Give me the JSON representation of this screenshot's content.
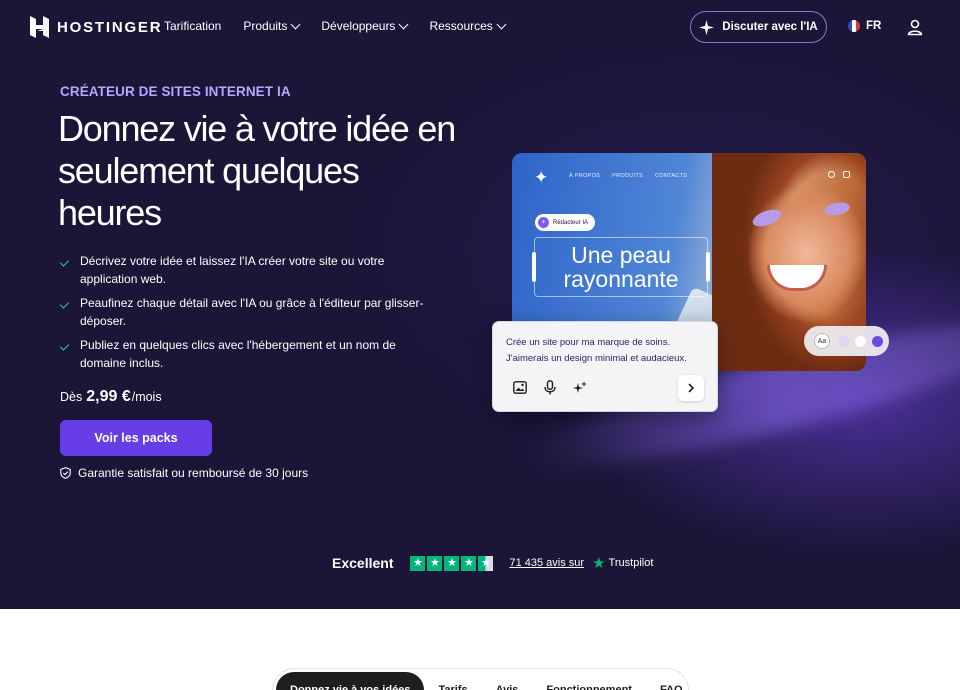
{
  "brand": {
    "name": "HOSTINGER"
  },
  "nav": {
    "links": [
      {
        "label": "Tarification",
        "dropdown": false
      },
      {
        "label": "Produits",
        "dropdown": true
      },
      {
        "label": "Développeurs",
        "dropdown": true
      },
      {
        "label": "Ressources",
        "dropdown": true
      }
    ],
    "ai_chat_label": "Discuter avec l'IA",
    "language": "FR"
  },
  "hero": {
    "eyebrow": "CRÉATEUR DE SITES INTERNET IA",
    "headline": "Donnez vie à votre idée en seulement quelques heures",
    "bullets": [
      "Décrivez votre idée et laissez l'IA créer votre site ou votre application web.",
      "Peaufinez chaque détail avec l'IA ou grâce à l'éditeur par glisser-déposer.",
      "Publiez en quelques clics avec l'hébergement et un nom de domaine inclus."
    ],
    "price_prefix": "Dès",
    "price_amount": "2,99 €",
    "price_suffix": "/mois",
    "cta_label": "Voir les packs",
    "guarantee": "Garantie satisfait ou remboursé de 30 jours"
  },
  "mockup": {
    "nav": [
      "À PROPOS",
      "PRODUITS",
      "CONTACTS"
    ],
    "ai_badge": "Rédacteur IA",
    "heading": "Une peau rayonnante",
    "prompt_text": "Crée un site pour ma marque de soins. J'aimerais un design minimal et audacieux.",
    "font_chip": "Aa",
    "swatches": [
      "#dcd6f0",
      "#ffffff",
      "#6a4ae0"
    ]
  },
  "trust": {
    "rating_label": "Excellent",
    "stars": 4.5,
    "reviews": "71 435 avis sur",
    "brand": "Trustpilot"
  },
  "tabs": [
    {
      "label": "Donnez vie à vos idées",
      "active": true
    },
    {
      "label": "Tarifs",
      "active": false
    },
    {
      "label": "Avis",
      "active": false
    },
    {
      "label": "Fonctionnement",
      "active": false
    },
    {
      "label": "FAQ",
      "active": false
    }
  ],
  "colors": {
    "hero_bg": "#1b1538",
    "accent": "#673de6",
    "eyebrow": "#b8a6ff",
    "check": "#2ecc8f",
    "trustpilot": "#00b67a"
  }
}
